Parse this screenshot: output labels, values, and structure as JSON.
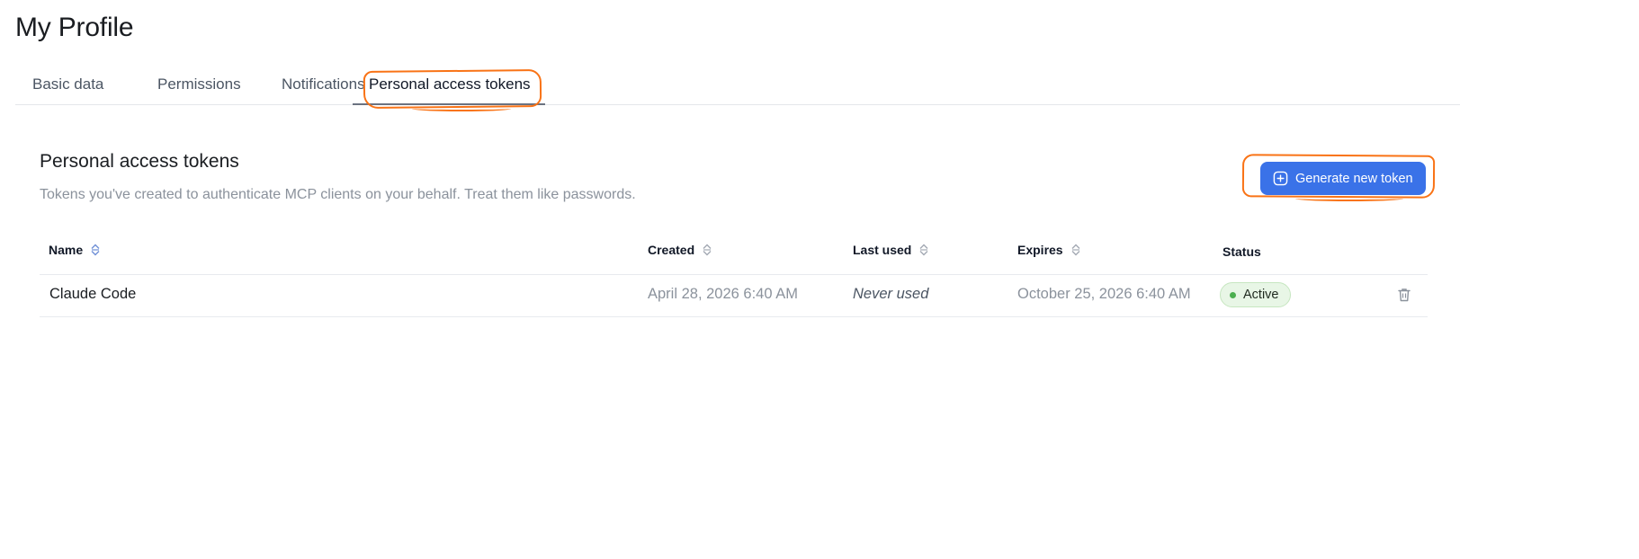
{
  "page": {
    "title": "My Profile"
  },
  "tabs": [
    {
      "label": "Basic data",
      "active": false
    },
    {
      "label": "Permissions",
      "active": false
    },
    {
      "label": "Notifications",
      "active": false
    },
    {
      "label": "Personal access tokens",
      "active": true
    }
  ],
  "section": {
    "title": "Personal access tokens",
    "description": "Tokens you've created to authenticate MCP clients on your behalf. Treat them like passwords.",
    "generate_button_label": "Generate new token",
    "generate_button_icon": "plus-square-icon"
  },
  "table": {
    "columns": [
      {
        "label": "Name",
        "sortable": true
      },
      {
        "label": "Created",
        "sortable": true
      },
      {
        "label": "Last used",
        "sortable": true
      },
      {
        "label": "Expires",
        "sortable": true
      },
      {
        "label": "Status",
        "sortable": false
      }
    ],
    "rows": [
      {
        "name": "Claude Code",
        "created": "April 28, 2026 6:40 AM",
        "last_used": "Never used",
        "expires": "October 25, 2026 6:40 AM",
        "status": "Active",
        "delete_icon": "trash-icon"
      }
    ]
  },
  "colors": {
    "accent": "#3a72e8",
    "annotation": "#f97316",
    "status_active_bg": "#e8f6e6",
    "status_active_dot": "#4caf50"
  }
}
